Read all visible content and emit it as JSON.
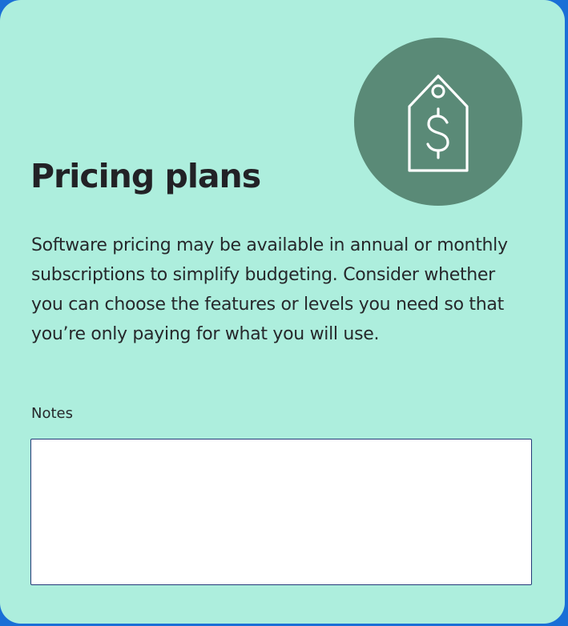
{
  "card": {
    "icon": "price-tag-dollar-icon",
    "title": "Pricing plans",
    "description": "Software pricing may be available in annual or monthly subscriptions to simplify budgeting. Consider whether you can choose the features or levels you need so that you’re only paying for what you will use."
  },
  "notes": {
    "label": "Notes",
    "value": ""
  },
  "colors": {
    "page_background": "#1a6fd6",
    "card_background": "#adeedd",
    "icon_circle": "#5a8a77",
    "icon_stroke": "#ffffff",
    "text": "#222226",
    "field_border": "#233a78"
  }
}
